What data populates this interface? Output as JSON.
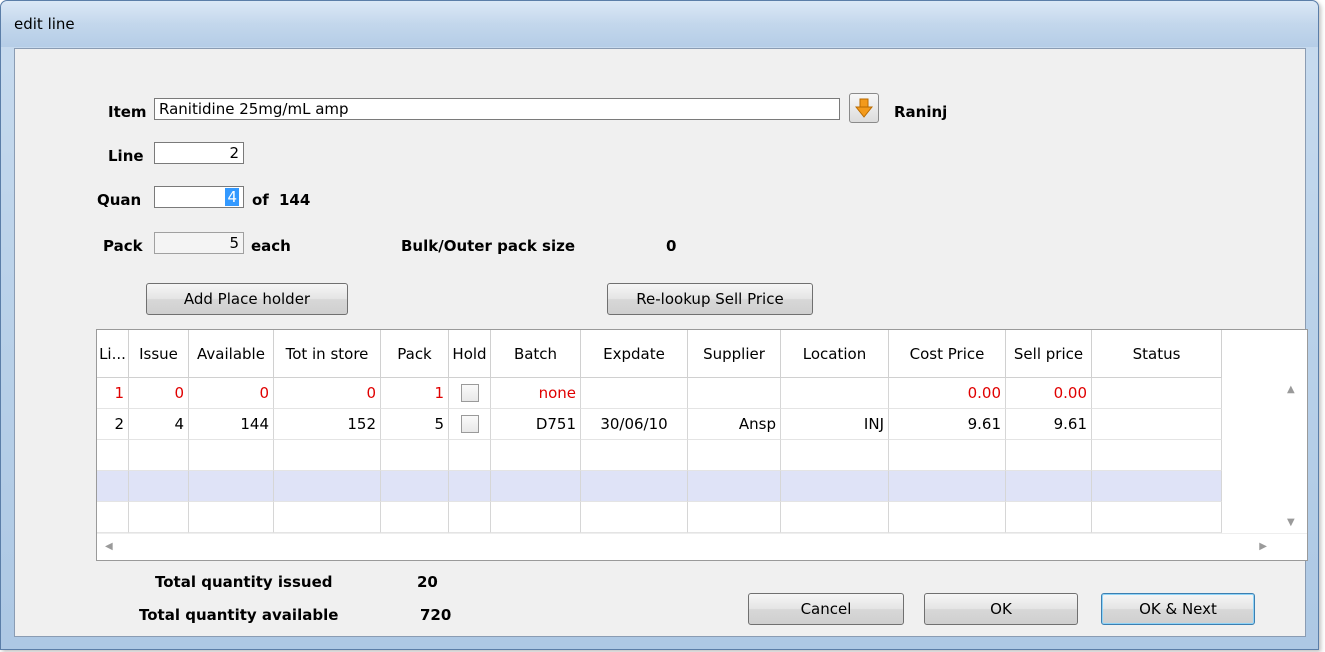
{
  "window": {
    "title": "edit line"
  },
  "form": {
    "item_label": "Item",
    "item_value": "Ranitidine 25mg/mL amp",
    "item_code": "Raninj",
    "line_label": "Line",
    "line_value": "2",
    "quan_label": "Quan",
    "quan_value": "4",
    "quan_of": "of",
    "quan_total": "144",
    "pack_label": "Pack",
    "pack_value": "5",
    "pack_unit": "each",
    "bulk_label": "Bulk/Outer pack size",
    "bulk_value": "0"
  },
  "buttons": {
    "add_placeholder": "Add Place holder",
    "relookup": "Re-lookup Sell Price",
    "cancel": "Cancel",
    "ok": "OK",
    "ok_next": "OK & Next"
  },
  "table": {
    "columns": [
      "Li...",
      "Issue",
      "Available",
      "Tot in store",
      "Pack",
      "Hold",
      "Batch",
      "Expdate",
      "Supplier",
      "Location",
      "Cost Price",
      "Sell price",
      "Status"
    ],
    "rows": [
      [
        "1",
        "0",
        "0",
        "0",
        "1",
        "",
        "none",
        "",
        "",
        "",
        "0.00",
        "0.00",
        ""
      ],
      [
        "2",
        "4",
        "144",
        "152",
        "5",
        "",
        "D751",
        "30/06/10",
        "Ansp",
        "INJ",
        "9.61",
        "9.61",
        ""
      ]
    ]
  },
  "totals": {
    "issued_label": "Total quantity issued",
    "issued_value": "20",
    "available_label": "Total quantity available",
    "available_value": "720"
  },
  "colors": {
    "highlight_row": "#dfe3f7",
    "red_text": "#e00000",
    "selection": "#3399ff"
  },
  "icons": {
    "item_lookup": "orange-down-arrow-icon"
  }
}
